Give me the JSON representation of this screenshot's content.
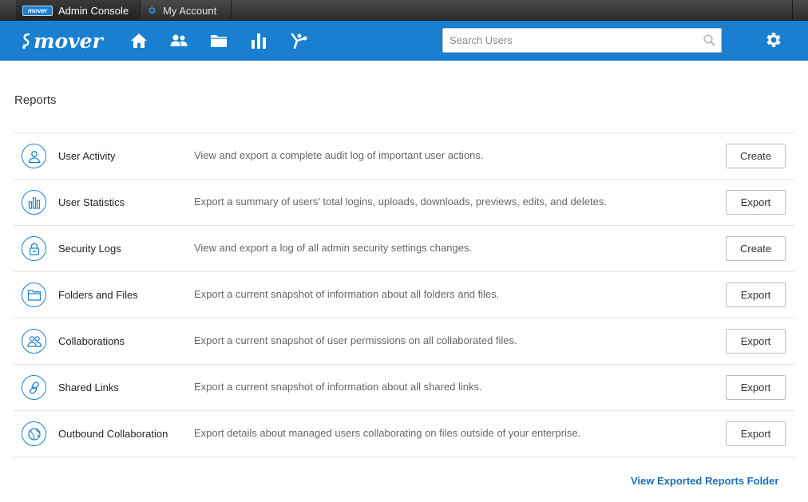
{
  "top_tabs": {
    "admin": {
      "logo_text": "mover",
      "label": "Admin Console"
    },
    "account": {
      "label": "My Account"
    }
  },
  "header": {
    "logo_text": "mover",
    "nav_icons": [
      "home-icon",
      "users-icon",
      "folder-icon",
      "bar-chart-icon",
      "apps-icon"
    ],
    "search_placeholder": "Search Users",
    "accent_color": "#1a7fd1"
  },
  "page": {
    "title": "Reports"
  },
  "reports": [
    {
      "name": "User Activity",
      "icon": "user-icon",
      "description": "View and export a complete audit log of important user actions.",
      "action": "Create"
    },
    {
      "name": "User Statistics",
      "icon": "stats-icon",
      "description": "Export a summary of users' total logins, uploads, downloads, previews, edits, and deletes.",
      "action": "Export"
    },
    {
      "name": "Security Logs",
      "icon": "lock-icon",
      "description": "View and export a log of all admin security settings changes.",
      "action": "Create"
    },
    {
      "name": "Folders and Files",
      "icon": "folder-icon",
      "description": "Export a current snapshot of information about all folders and files.",
      "action": "Export"
    },
    {
      "name": "Collaborations",
      "icon": "collaborators-icon",
      "description": "Export a current snapshot of user permissions on all collaborated files.",
      "action": "Export"
    },
    {
      "name": "Shared Links",
      "icon": "link-icon",
      "description": "Export a current snapshot of information about all shared links.",
      "action": "Export"
    },
    {
      "name": "Outbound Collaboration",
      "icon": "globe-icon",
      "description": "Export details about managed users collaborating on files outside of your enterprise.",
      "action": "Export"
    }
  ],
  "footer": {
    "link_label": "View Exported Reports Folder"
  }
}
